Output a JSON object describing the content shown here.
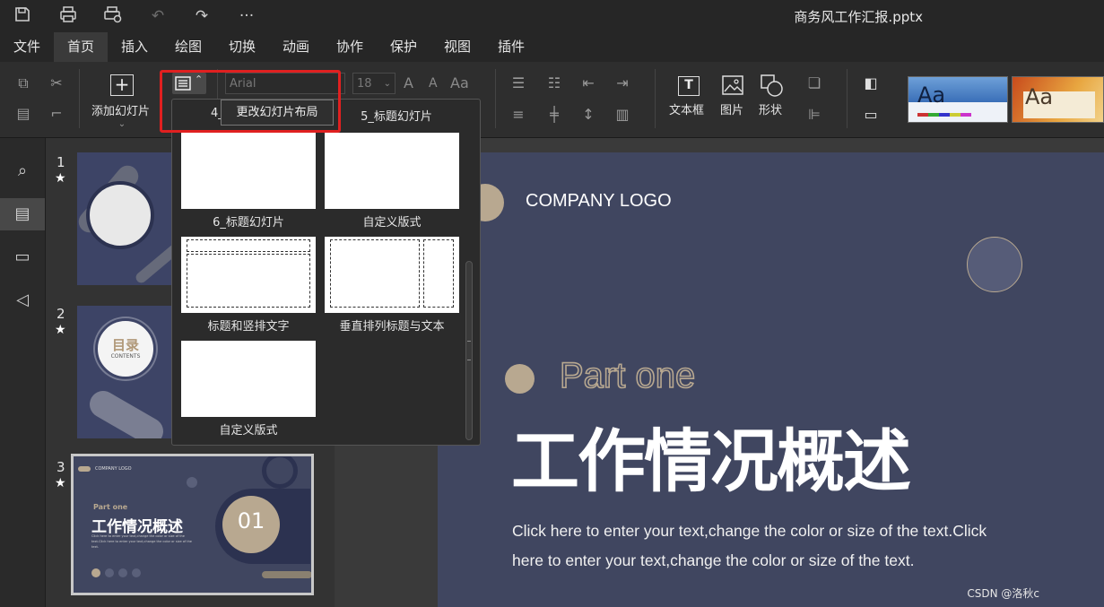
{
  "window": {
    "title": "商务风工作汇报.pptx"
  },
  "quick_access": {
    "more_label": "···"
  },
  "menu": {
    "items": [
      "文件",
      "首页",
      "插入",
      "绘图",
      "切换",
      "动画",
      "协作",
      "保护",
      "视图",
      "插件"
    ],
    "active": "首页"
  },
  "ribbon": {
    "add_slide_label": "添加幻灯片",
    "font_name": "Arial",
    "font_size": "18",
    "text_box_label": "文本框",
    "picture_label": "图片",
    "shape_label": "形状",
    "font_grow": "A",
    "font_shrink": "A",
    "change_case": "Aa"
  },
  "layout_dropdown": {
    "tooltip": "更改幻灯片布局",
    "top_labels": [
      "4_",
      "5_标题幻灯片"
    ],
    "layouts": [
      {
        "label": "6_标题幻灯片",
        "kind": "blank"
      },
      {
        "label": "自定义版式",
        "kind": "blank"
      },
      {
        "label": "标题和竖排文字",
        "kind": "title-vertical"
      },
      {
        "label": "垂直排列标题与文本",
        "kind": "vertical-title-text"
      },
      {
        "label": "自定义版式",
        "kind": "blank"
      }
    ]
  },
  "slides": [
    {
      "number": "1",
      "star": "★"
    },
    {
      "number": "2",
      "star": "★",
      "circle_title": "目录",
      "circle_sub": "CONTENTS"
    },
    {
      "number": "3",
      "star": "★",
      "logo": "COMPANY LOGO",
      "part": "Part one",
      "title": "工作情况概述",
      "body": "Click here to enter your text,change the color or size of the text.Click here to enter your text,change the color or size of the text.",
      "badge": "01"
    }
  ],
  "slide_view": {
    "logo": "COMPANY LOGO",
    "part": "Part one",
    "title": "工作情况概述",
    "body_line1": "Click here to enter your text,change the color or size of the text.Click",
    "body_line2": "here to enter your text,change the color or size of the text."
  },
  "watermark": "CSDN @洛秋c",
  "colors": {
    "slide_bg": "#404660",
    "accent_tan": "#b8a890",
    "highlight": "#e02020"
  }
}
